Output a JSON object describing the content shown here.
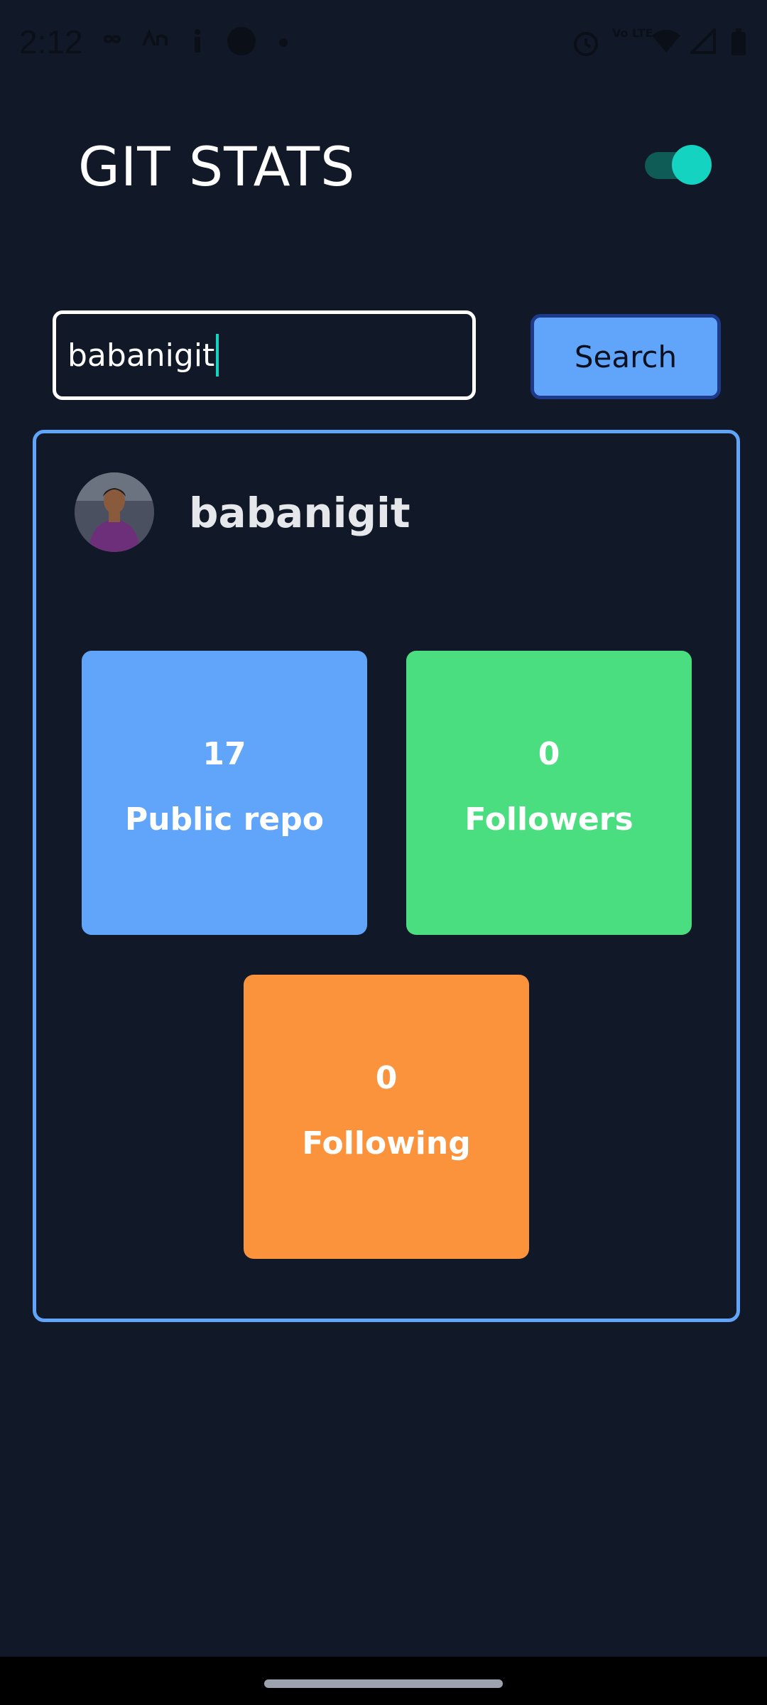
{
  "status_bar": {
    "time": "2:12",
    "icons": [
      "infinity-icon",
      "bn-icon",
      "info-icon",
      "app-icon",
      "dot-icon",
      "alarm-icon",
      "volte-icon",
      "wifi-icon",
      "signal-icon",
      "battery-icon"
    ],
    "volte_label": "Vo LTE"
  },
  "header": {
    "title": "GIT STATS",
    "theme_toggle_on": true
  },
  "search": {
    "value": "babanigit",
    "button_label": "Search"
  },
  "profile": {
    "username": "babanigit",
    "avatar": "user-avatar-photo"
  },
  "stats": {
    "public_repos": {
      "value": "17",
      "label": "Public repo"
    },
    "followers": {
      "value": "0",
      "label": "Followers"
    },
    "following": {
      "value": "0",
      "label": "Following"
    }
  },
  "colors": {
    "background": "#111827",
    "accent_blue": "#60a5fa",
    "accent_green": "#4ade80",
    "accent_orange": "#fb923c",
    "toggle_teal": "#14d3c0"
  }
}
